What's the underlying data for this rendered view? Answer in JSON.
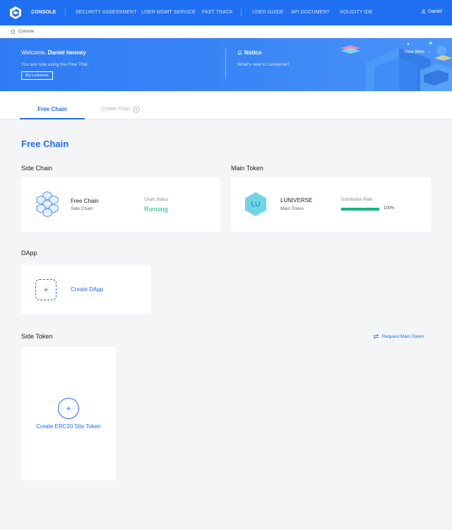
{
  "nav": {
    "console": "CONSOLE",
    "items": [
      "SECURITY ASSESSMENT",
      "USER MGMT SERVICE",
      "FAST TRACK"
    ],
    "items2": [
      "USER GUIDE",
      "API DOCUMENT",
      "SOLIDITY IDE"
    ],
    "user": "Daniel"
  },
  "breadcrumb": "Console",
  "banner": {
    "welcome_prefix": "Welcome, ",
    "welcome_name": "Daniel henney",
    "trial": "You are now using the Free Trial.",
    "my_button": "My Luniverse",
    "notice_title": "Notice",
    "whats_new": "What's new in Luniverse?",
    "view_more": "View More"
  },
  "tabs": {
    "free_chain": "Free Chain",
    "create_chain": "Create Chain"
  },
  "page_title": "Free Chain",
  "side_chain": {
    "section": "Side Chain",
    "name": "Free Chain",
    "type": "Side Chain",
    "status_label": "Chain Status",
    "status": "Running"
  },
  "main_token": {
    "section": "Main Token",
    "symbol": "LU",
    "name": "LUNIVERSE",
    "type": "Main Token",
    "dist_label": "Distribution Rate",
    "dist_pct": "100%",
    "dist_fraction": 1.0
  },
  "dapp": {
    "section": "DApp",
    "create": "Create DApp"
  },
  "side_token": {
    "section": "Side Token",
    "request": "Request Main Token",
    "create": "Create ERC20 Site Token"
  },
  "colors": {
    "primary": "#1e6ff1",
    "success": "#18b57e",
    "hex": "#6fd5e3"
  }
}
